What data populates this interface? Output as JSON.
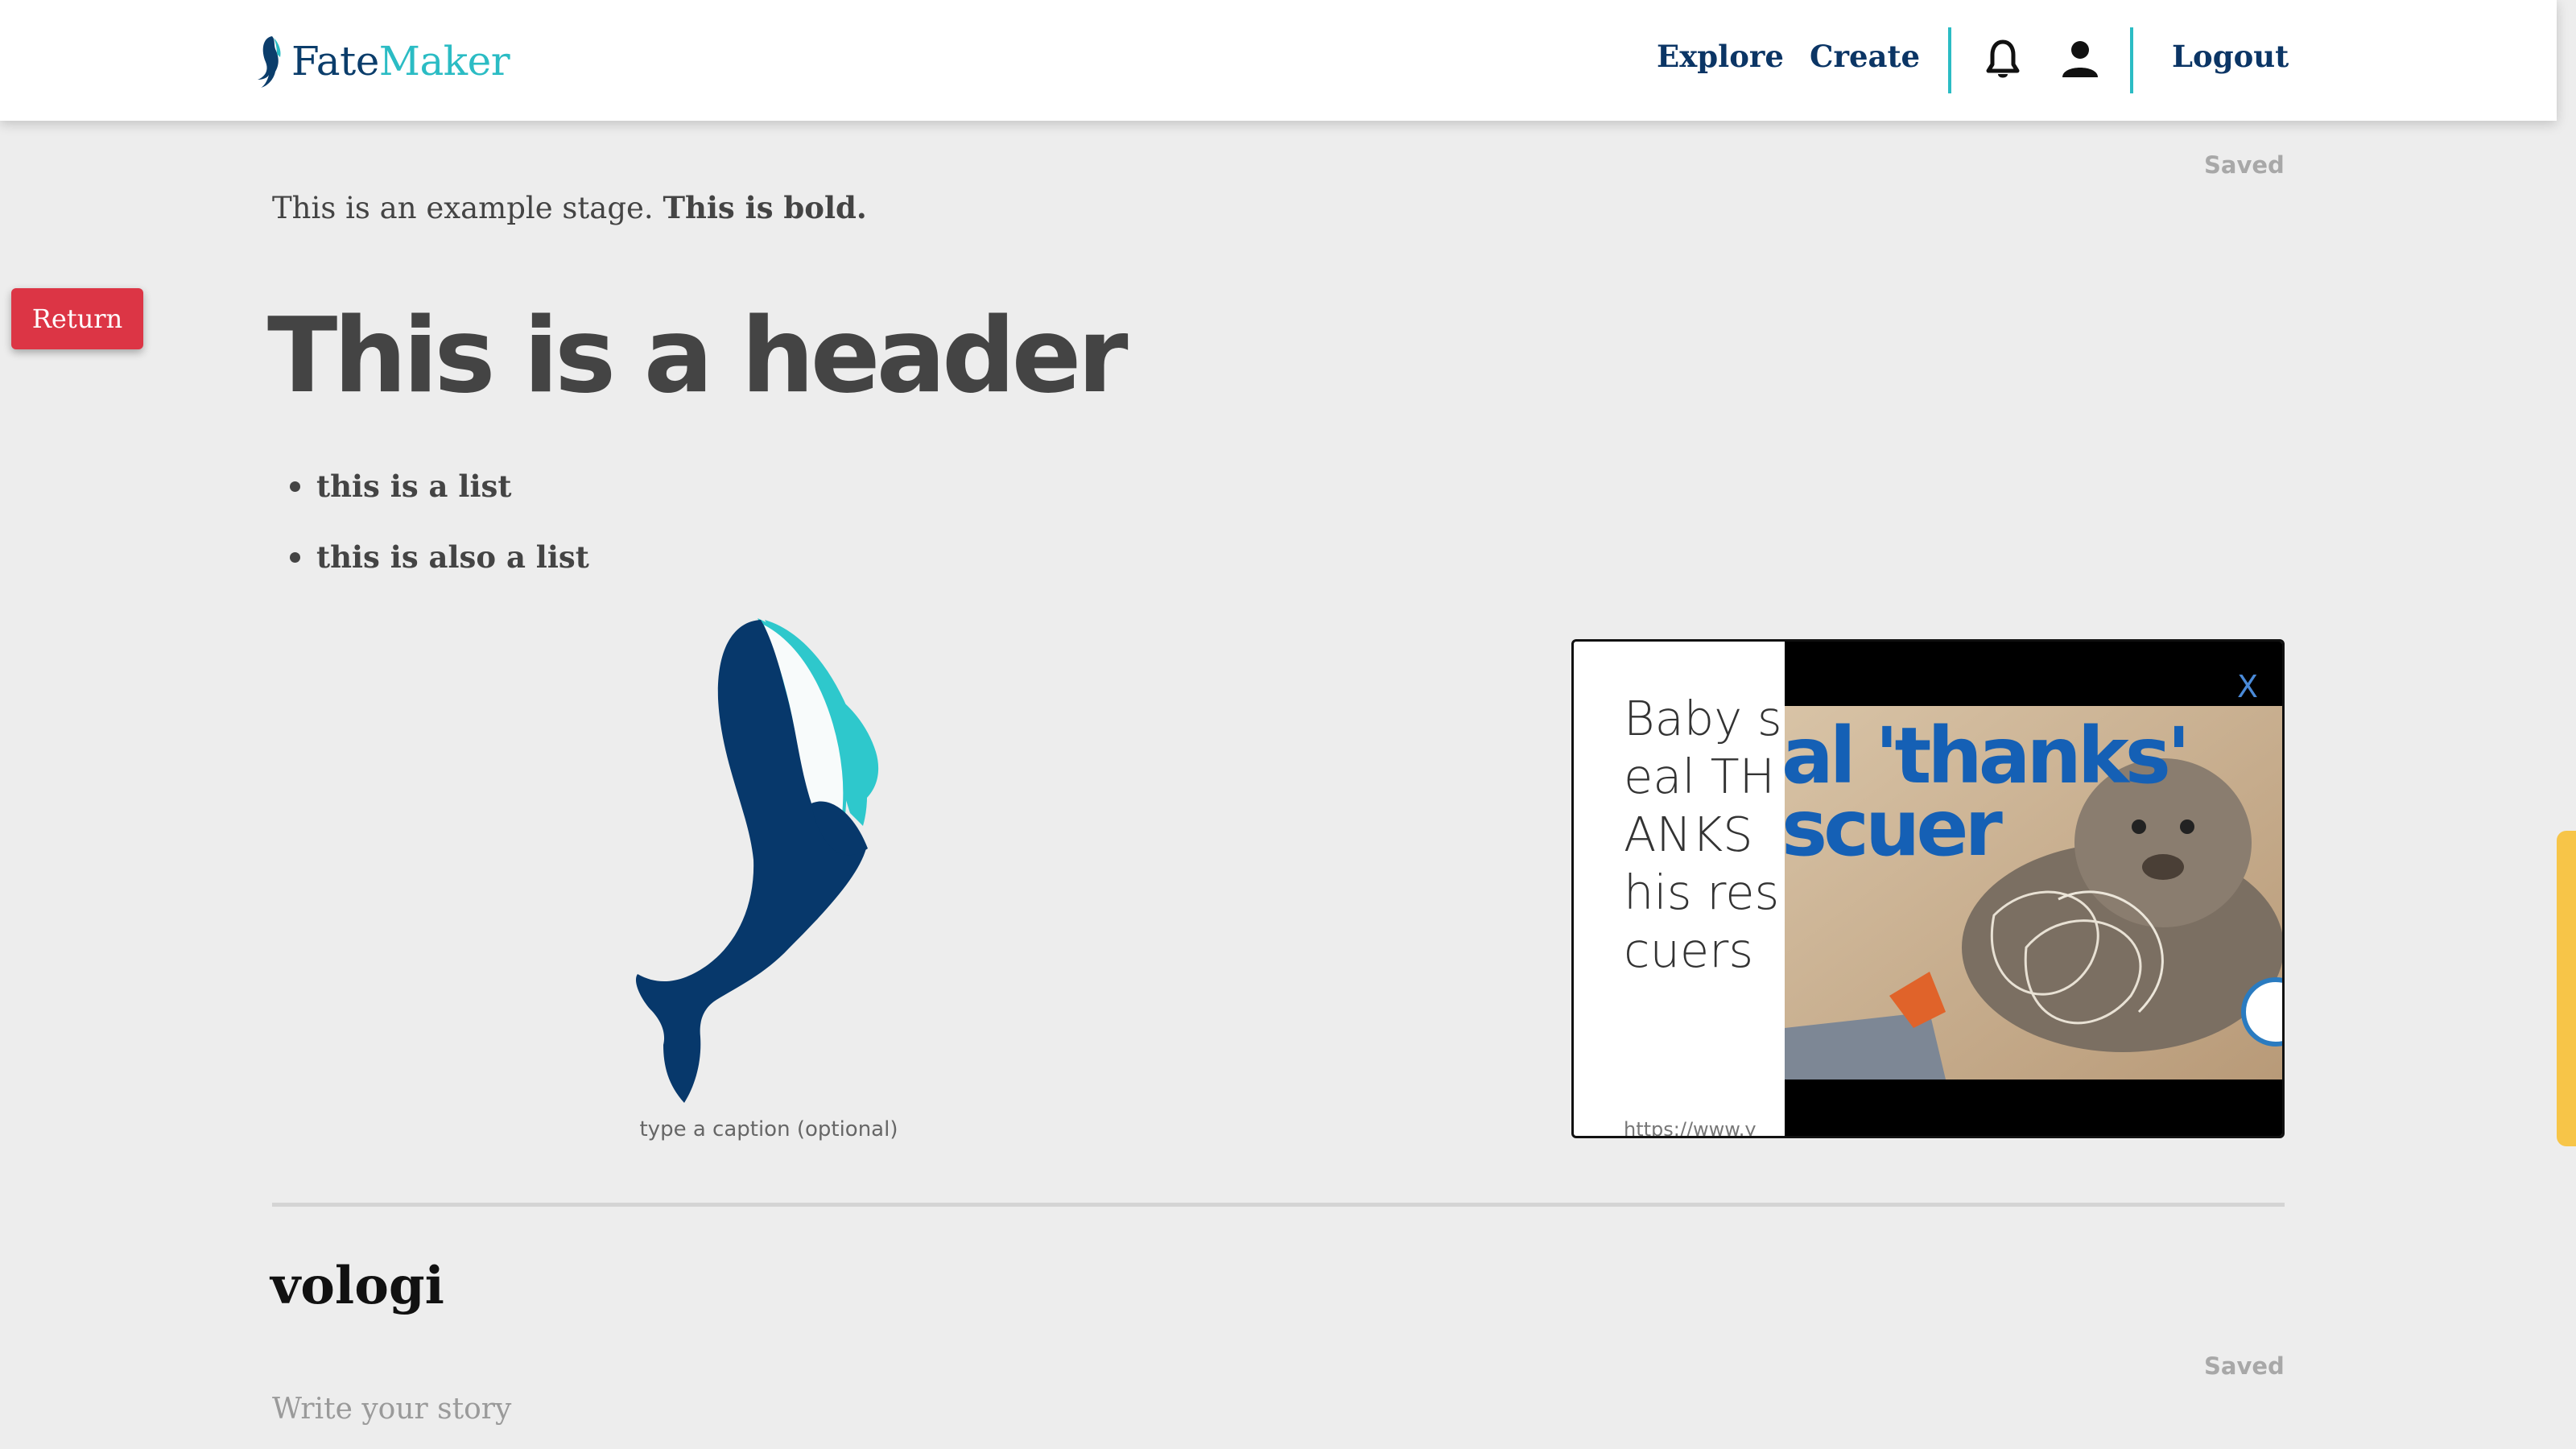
{
  "navbar": {
    "brand_part1": "Fate",
    "brand_part2": "Maker",
    "explore_label": "Explore",
    "create_label": "Create",
    "logout_label": "Logout",
    "icons": [
      "bell-icon",
      "user-icon"
    ]
  },
  "return_label": "Return",
  "stage": {
    "saved_label": "Saved",
    "intro_text": "This is an example stage. ",
    "intro_bold": "This is bold.",
    "header": "This is a header",
    "list": [
      "this is a list",
      "this is also a list"
    ],
    "image_caption": "type a caption (optional)",
    "embed": {
      "text": "Baby seal THANKS his rescuers",
      "url": "https://www.y",
      "close_label": "X",
      "overlay_line1": "al 'thanks'",
      "overlay_line2": "scuer"
    }
  },
  "story": {
    "title": "vologi",
    "saved_label": "Saved",
    "placeholder": "Write your story"
  },
  "colors": {
    "brand_dark": "#0b3d6b",
    "brand_teal": "#2bbcc4",
    "return_red": "#dc3545",
    "background": "#ededed"
  }
}
